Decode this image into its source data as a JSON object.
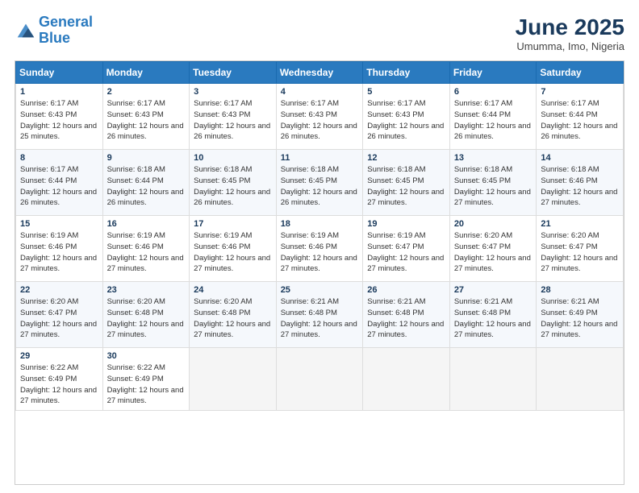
{
  "header": {
    "logo_line1": "General",
    "logo_line2": "Blue",
    "title": "June 2025",
    "subtitle": "Umumma, Imo, Nigeria"
  },
  "weekdays": [
    "Sunday",
    "Monday",
    "Tuesday",
    "Wednesday",
    "Thursday",
    "Friday",
    "Saturday"
  ],
  "weeks": [
    [
      {
        "day": "1",
        "sunrise": "6:17 AM",
        "sunset": "6:43 PM",
        "daylight": "12 hours and 25 minutes."
      },
      {
        "day": "2",
        "sunrise": "6:17 AM",
        "sunset": "6:43 PM",
        "daylight": "12 hours and 26 minutes."
      },
      {
        "day": "3",
        "sunrise": "6:17 AM",
        "sunset": "6:43 PM",
        "daylight": "12 hours and 26 minutes."
      },
      {
        "day": "4",
        "sunrise": "6:17 AM",
        "sunset": "6:43 PM",
        "daylight": "12 hours and 26 minutes."
      },
      {
        "day": "5",
        "sunrise": "6:17 AM",
        "sunset": "6:43 PM",
        "daylight": "12 hours and 26 minutes."
      },
      {
        "day": "6",
        "sunrise": "6:17 AM",
        "sunset": "6:44 PM",
        "daylight": "12 hours and 26 minutes."
      },
      {
        "day": "7",
        "sunrise": "6:17 AM",
        "sunset": "6:44 PM",
        "daylight": "12 hours and 26 minutes."
      }
    ],
    [
      {
        "day": "8",
        "sunrise": "6:17 AM",
        "sunset": "6:44 PM",
        "daylight": "12 hours and 26 minutes."
      },
      {
        "day": "9",
        "sunrise": "6:18 AM",
        "sunset": "6:44 PM",
        "daylight": "12 hours and 26 minutes."
      },
      {
        "day": "10",
        "sunrise": "6:18 AM",
        "sunset": "6:45 PM",
        "daylight": "12 hours and 26 minutes."
      },
      {
        "day": "11",
        "sunrise": "6:18 AM",
        "sunset": "6:45 PM",
        "daylight": "12 hours and 26 minutes."
      },
      {
        "day": "12",
        "sunrise": "6:18 AM",
        "sunset": "6:45 PM",
        "daylight": "12 hours and 27 minutes."
      },
      {
        "day": "13",
        "sunrise": "6:18 AM",
        "sunset": "6:45 PM",
        "daylight": "12 hours and 27 minutes."
      },
      {
        "day": "14",
        "sunrise": "6:18 AM",
        "sunset": "6:46 PM",
        "daylight": "12 hours and 27 minutes."
      }
    ],
    [
      {
        "day": "15",
        "sunrise": "6:19 AM",
        "sunset": "6:46 PM",
        "daylight": "12 hours and 27 minutes."
      },
      {
        "day": "16",
        "sunrise": "6:19 AM",
        "sunset": "6:46 PM",
        "daylight": "12 hours and 27 minutes."
      },
      {
        "day": "17",
        "sunrise": "6:19 AM",
        "sunset": "6:46 PM",
        "daylight": "12 hours and 27 minutes."
      },
      {
        "day": "18",
        "sunrise": "6:19 AM",
        "sunset": "6:46 PM",
        "daylight": "12 hours and 27 minutes."
      },
      {
        "day": "19",
        "sunrise": "6:19 AM",
        "sunset": "6:47 PM",
        "daylight": "12 hours and 27 minutes."
      },
      {
        "day": "20",
        "sunrise": "6:20 AM",
        "sunset": "6:47 PM",
        "daylight": "12 hours and 27 minutes."
      },
      {
        "day": "21",
        "sunrise": "6:20 AM",
        "sunset": "6:47 PM",
        "daylight": "12 hours and 27 minutes."
      }
    ],
    [
      {
        "day": "22",
        "sunrise": "6:20 AM",
        "sunset": "6:47 PM",
        "daylight": "12 hours and 27 minutes."
      },
      {
        "day": "23",
        "sunrise": "6:20 AM",
        "sunset": "6:48 PM",
        "daylight": "12 hours and 27 minutes."
      },
      {
        "day": "24",
        "sunrise": "6:20 AM",
        "sunset": "6:48 PM",
        "daylight": "12 hours and 27 minutes."
      },
      {
        "day": "25",
        "sunrise": "6:21 AM",
        "sunset": "6:48 PM",
        "daylight": "12 hours and 27 minutes."
      },
      {
        "day": "26",
        "sunrise": "6:21 AM",
        "sunset": "6:48 PM",
        "daylight": "12 hours and 27 minutes."
      },
      {
        "day": "27",
        "sunrise": "6:21 AM",
        "sunset": "6:48 PM",
        "daylight": "12 hours and 27 minutes."
      },
      {
        "day": "28",
        "sunrise": "6:21 AM",
        "sunset": "6:49 PM",
        "daylight": "12 hours and 27 minutes."
      }
    ],
    [
      {
        "day": "29",
        "sunrise": "6:22 AM",
        "sunset": "6:49 PM",
        "daylight": "12 hours and 27 minutes."
      },
      {
        "day": "30",
        "sunrise": "6:22 AM",
        "sunset": "6:49 PM",
        "daylight": "12 hours and 27 minutes."
      },
      null,
      null,
      null,
      null,
      null
    ]
  ]
}
